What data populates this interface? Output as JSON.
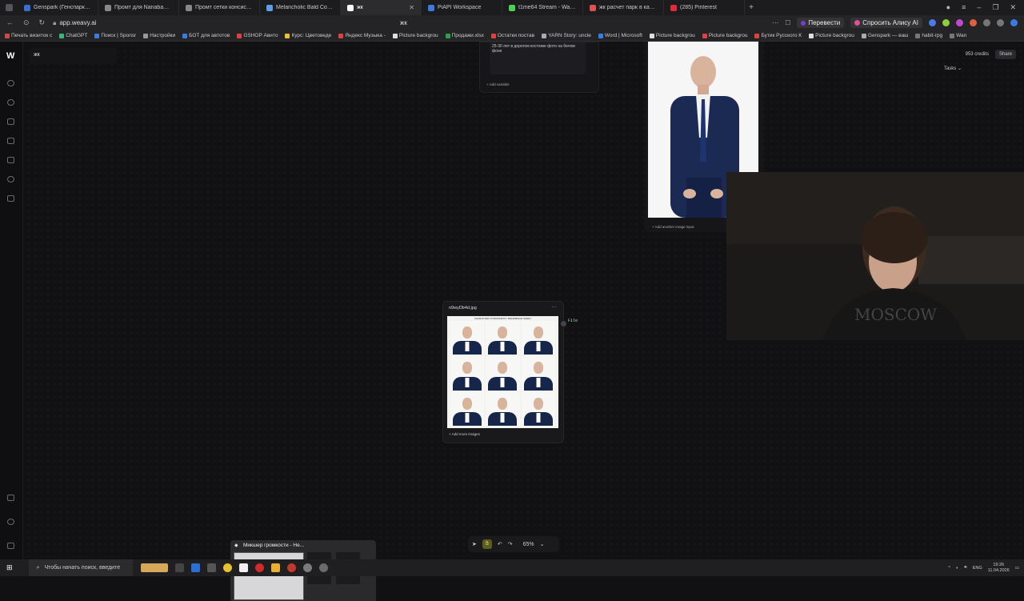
{
  "tabs": [
    {
      "label": "Genspark (Генспарк) — а",
      "color": "#3b6fd6"
    },
    {
      "label": "Промт для Nanabanana Сет",
      "color": "#888"
    },
    {
      "label": "Промт сетки консистент",
      "color": "#888"
    },
    {
      "label": "Melancholic Bald Corpora",
      "color": "#5aa0e8"
    },
    {
      "label": "жк",
      "color": "#ffffff",
      "active": true
    },
    {
      "label": "PiAPI Workspace",
      "color": "#3a7be0"
    },
    {
      "label": "t1me64 Stream - Watch Li",
      "color": "#4ccf5a"
    },
    {
      "label": "жк расчет парк в калин",
      "color": "#e05050"
    },
    {
      "label": "(285) Pinterest",
      "color": "#e02a3a"
    }
  ],
  "address": {
    "url": "app.weavy.ai",
    "page_title": "жк",
    "translate": "Перевести",
    "alice": "Спросить Алису AI"
  },
  "bookmarks": [
    "Печать визиток с",
    "ChatGPT",
    "Поиск | Sponsr",
    "Настройки",
    "БОТ для автотов",
    "GSHOP Авито",
    "Курс: Цветоведе",
    "Яндекс Музыка -",
    "Picture backgrou",
    "Продажи.xlsx",
    "Остатки постав",
    "YARN Story: uncle",
    "Word | Microsoft",
    "Picture backgrou",
    "Picture backgrou",
    "Бутик Русского К",
    "Picture backgrou",
    "Genspark — ваш",
    "habit-rpg",
    "Wan"
  ],
  "app": {
    "project_name": "жк",
    "credits": "953 credits",
    "share": "Share",
    "tasks": "Tasks",
    "prompt_node": {
      "text": "25-30 лет в дорогом костюме фото на белом фоне",
      "add_label": "Add variable"
    },
    "image_input_node": {
      "add_label": "Add another image input"
    },
    "file_node": {
      "title": "n9wyDb4d.jpg",
      "add_label": "+ Add more images",
      "output_label": "File",
      "sheet_header": "CHARACTER CONSISTENCY REFERENCE SHEET"
    },
    "zoom": "65%"
  },
  "taskbar": {
    "search_placeholder": "Чтобы начать поиск, введите",
    "preview_title": "Микшер громкости - Не...",
    "lang": "ENG",
    "time": "19:26",
    "date": "11.04.2026"
  }
}
